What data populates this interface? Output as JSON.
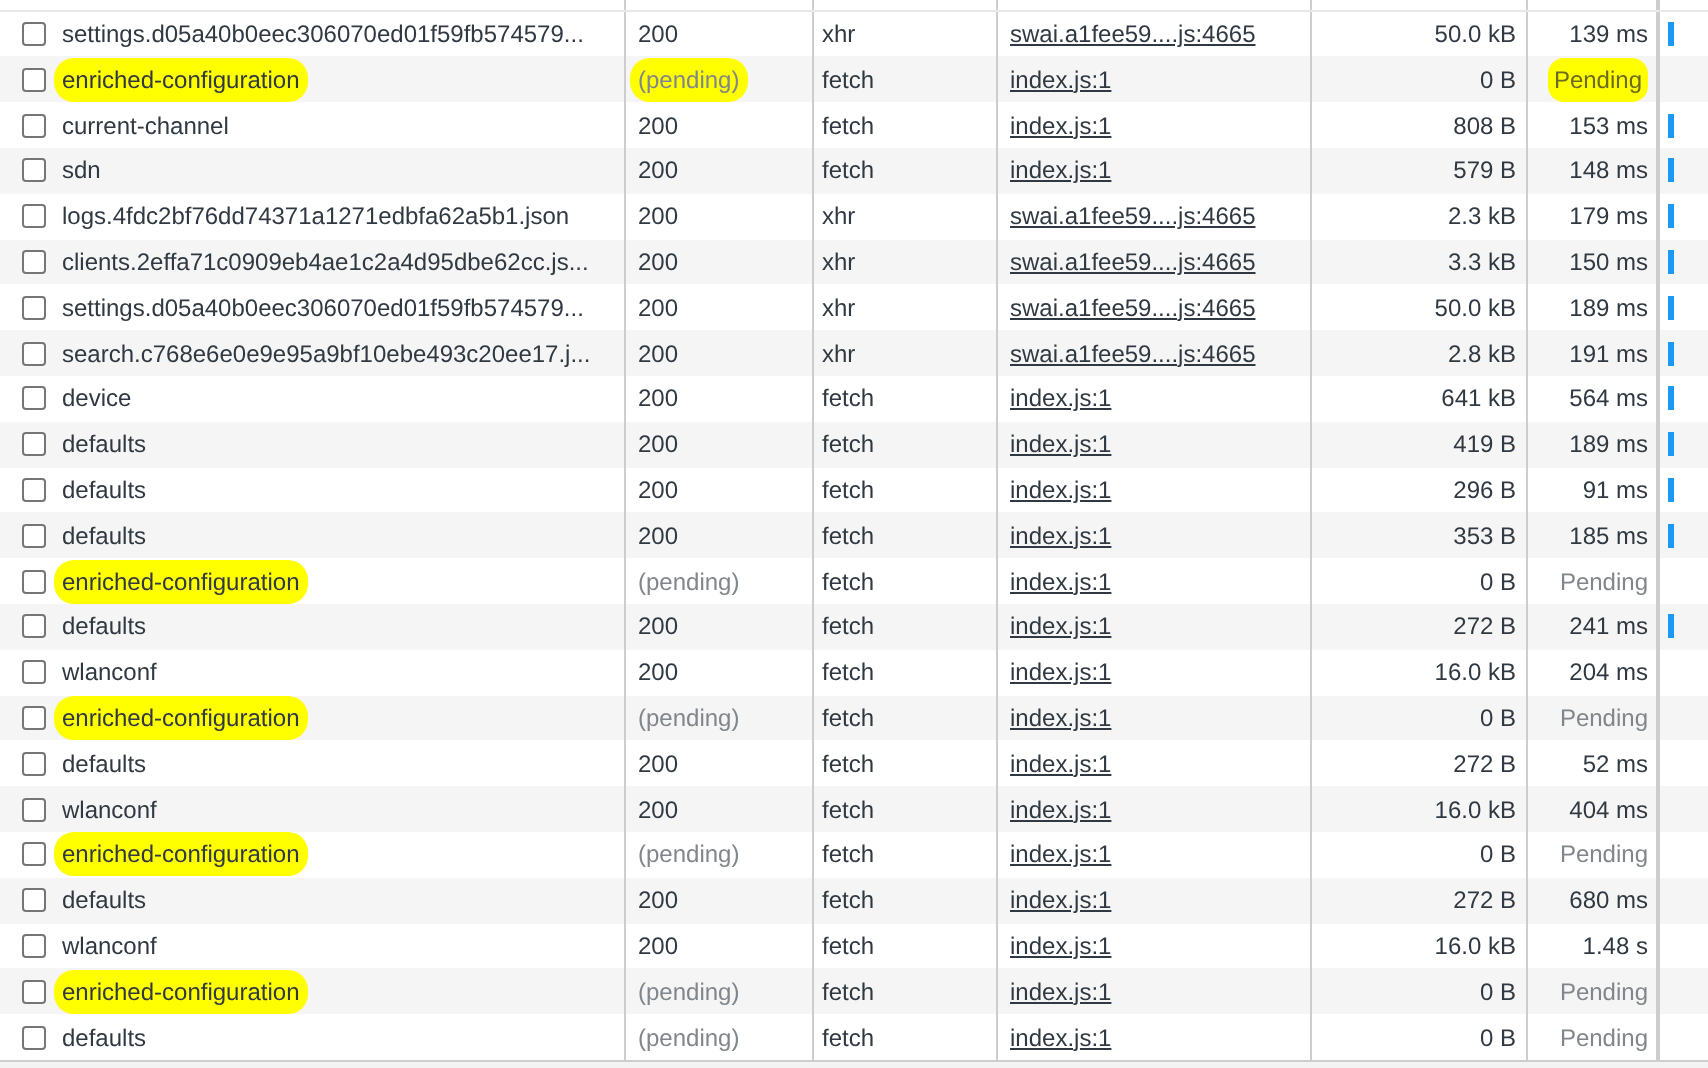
{
  "rows": [
    {
      "checked": false,
      "name": "settings.d05a40b0eec306070ed01f59fb574579...",
      "status": "200",
      "type": "xhr",
      "initiator": "swai.a1fee59....js:4665",
      "size": "50.0 kB",
      "time": "139 ms",
      "name_highlighted": false,
      "status_highlighted": false,
      "time_highlighted": false,
      "timeline_bar": true
    },
    {
      "checked": false,
      "name": "enriched-configuration",
      "status": "(pending)",
      "type": "fetch",
      "initiator": "index.js:1",
      "size": "0 B",
      "time": "Pending",
      "name_highlighted": true,
      "status_highlighted": true,
      "time_highlighted": true,
      "timeline_bar": false
    },
    {
      "checked": false,
      "name": "current-channel",
      "status": "200",
      "type": "fetch",
      "initiator": "index.js:1",
      "size": "808 B",
      "time": "153 ms",
      "name_highlighted": false,
      "status_highlighted": false,
      "time_highlighted": false,
      "timeline_bar": true
    },
    {
      "checked": false,
      "name": "sdn",
      "status": "200",
      "type": "fetch",
      "initiator": "index.js:1",
      "size": "579 B",
      "time": "148 ms",
      "name_highlighted": false,
      "status_highlighted": false,
      "time_highlighted": false,
      "timeline_bar": true
    },
    {
      "checked": false,
      "name": "logs.4fdc2bf76dd74371a1271edbfa62a5b1.json",
      "status": "200",
      "type": "xhr",
      "initiator": "swai.a1fee59....js:4665",
      "size": "2.3 kB",
      "time": "179 ms",
      "name_highlighted": false,
      "status_highlighted": false,
      "time_highlighted": false,
      "timeline_bar": true
    },
    {
      "checked": false,
      "name": "clients.2effa71c0909eb4ae1c2a4d95dbe62cc.js...",
      "status": "200",
      "type": "xhr",
      "initiator": "swai.a1fee59....js:4665",
      "size": "3.3 kB",
      "time": "150 ms",
      "name_highlighted": false,
      "status_highlighted": false,
      "time_highlighted": false,
      "timeline_bar": true
    },
    {
      "checked": false,
      "name": "settings.d05a40b0eec306070ed01f59fb574579...",
      "status": "200",
      "type": "xhr",
      "initiator": "swai.a1fee59....js:4665",
      "size": "50.0 kB",
      "time": "189 ms",
      "name_highlighted": false,
      "status_highlighted": false,
      "time_highlighted": false,
      "timeline_bar": true
    },
    {
      "checked": false,
      "name": "search.c768e6e0e9e95a9bf10ebe493c20ee17.j...",
      "status": "200",
      "type": "xhr",
      "initiator": "swai.a1fee59....js:4665",
      "size": "2.8 kB",
      "time": "191 ms",
      "name_highlighted": false,
      "status_highlighted": false,
      "time_highlighted": false,
      "timeline_bar": true
    },
    {
      "checked": false,
      "name": "device",
      "status": "200",
      "type": "fetch",
      "initiator": "index.js:1",
      "size": "641 kB",
      "time": "564 ms",
      "name_highlighted": false,
      "status_highlighted": false,
      "time_highlighted": false,
      "timeline_bar": true
    },
    {
      "checked": false,
      "name": "defaults",
      "status": "200",
      "type": "fetch",
      "initiator": "index.js:1",
      "size": "419 B",
      "time": "189 ms",
      "name_highlighted": false,
      "status_highlighted": false,
      "time_highlighted": false,
      "timeline_bar": true
    },
    {
      "checked": false,
      "name": "defaults",
      "status": "200",
      "type": "fetch",
      "initiator": "index.js:1",
      "size": "296 B",
      "time": "91 ms",
      "name_highlighted": false,
      "status_highlighted": false,
      "time_highlighted": false,
      "timeline_bar": true
    },
    {
      "checked": false,
      "name": "defaults",
      "status": "200",
      "type": "fetch",
      "initiator": "index.js:1",
      "size": "353 B",
      "time": "185 ms",
      "name_highlighted": false,
      "status_highlighted": false,
      "time_highlighted": false,
      "timeline_bar": true
    },
    {
      "checked": false,
      "name": "enriched-configuration",
      "status": "(pending)",
      "type": "fetch",
      "initiator": "index.js:1",
      "size": "0 B",
      "time": "Pending",
      "name_highlighted": true,
      "status_highlighted": false,
      "time_highlighted": false,
      "timeline_bar": false
    },
    {
      "checked": false,
      "name": "defaults",
      "status": "200",
      "type": "fetch",
      "initiator": "index.js:1",
      "size": "272 B",
      "time": "241 ms",
      "name_highlighted": false,
      "status_highlighted": false,
      "time_highlighted": false,
      "timeline_bar": true
    },
    {
      "checked": false,
      "name": "wlanconf",
      "status": "200",
      "type": "fetch",
      "initiator": "index.js:1",
      "size": "16.0 kB",
      "time": "204 ms",
      "name_highlighted": false,
      "status_highlighted": false,
      "time_highlighted": false,
      "timeline_bar": false
    },
    {
      "checked": false,
      "name": "enriched-configuration",
      "status": "(pending)",
      "type": "fetch",
      "initiator": "index.js:1",
      "size": "0 B",
      "time": "Pending",
      "name_highlighted": true,
      "status_highlighted": false,
      "time_highlighted": false,
      "timeline_bar": false
    },
    {
      "checked": false,
      "name": "defaults",
      "status": "200",
      "type": "fetch",
      "initiator": "index.js:1",
      "size": "272 B",
      "time": "52 ms",
      "name_highlighted": false,
      "status_highlighted": false,
      "time_highlighted": false,
      "timeline_bar": false
    },
    {
      "checked": false,
      "name": "wlanconf",
      "status": "200",
      "type": "fetch",
      "initiator": "index.js:1",
      "size": "16.0 kB",
      "time": "404 ms",
      "name_highlighted": false,
      "status_highlighted": false,
      "time_highlighted": false,
      "timeline_bar": false
    },
    {
      "checked": false,
      "name": "enriched-configuration",
      "status": "(pending)",
      "type": "fetch",
      "initiator": "index.js:1",
      "size": "0 B",
      "time": "Pending",
      "name_highlighted": true,
      "status_highlighted": false,
      "time_highlighted": false,
      "timeline_bar": false
    },
    {
      "checked": false,
      "name": "defaults",
      "status": "200",
      "type": "fetch",
      "initiator": "index.js:1",
      "size": "272 B",
      "time": "680 ms",
      "name_highlighted": false,
      "status_highlighted": false,
      "time_highlighted": false,
      "timeline_bar": false
    },
    {
      "checked": false,
      "name": "wlanconf",
      "status": "200",
      "type": "fetch",
      "initiator": "index.js:1",
      "size": "16.0 kB",
      "time": "1.48 s",
      "name_highlighted": false,
      "status_highlighted": false,
      "time_highlighted": false,
      "timeline_bar": false
    },
    {
      "checked": false,
      "name": "enriched-configuration",
      "status": "(pending)",
      "type": "fetch",
      "initiator": "index.js:1",
      "size": "0 B",
      "time": "Pending",
      "name_highlighted": true,
      "status_highlighted": false,
      "time_highlighted": false,
      "timeline_bar": false
    },
    {
      "checked": false,
      "name": "defaults",
      "status": "(pending)",
      "type": "fetch",
      "initiator": "index.js:1",
      "size": "0 B",
      "time": "Pending",
      "name_highlighted": false,
      "status_highlighted": false,
      "time_highlighted": false,
      "timeline_bar": false
    }
  ]
}
